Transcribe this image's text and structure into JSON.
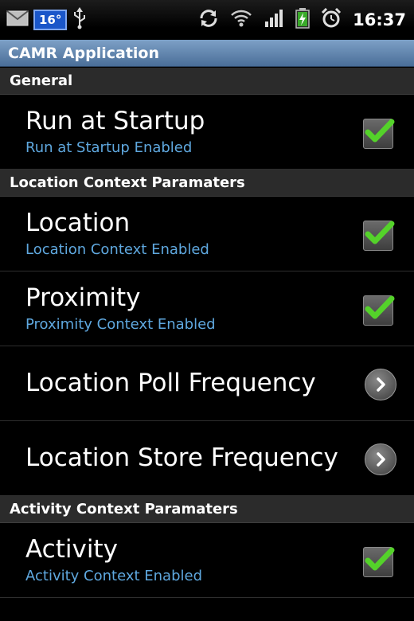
{
  "status_bar": {
    "temperature": "16°",
    "time": "16:37",
    "icons": [
      "mail-icon",
      "usb-icon",
      "sync-icon",
      "wifi-icon",
      "signal-icon",
      "battery-charging-icon",
      "alarm-icon"
    ]
  },
  "app": {
    "title": "CAMR Application"
  },
  "sections": [
    {
      "header": "General",
      "items": [
        {
          "title": "Run at Startup",
          "summary": "Run at Startup Enabled",
          "widget": "checkbox",
          "checked": true
        }
      ]
    },
    {
      "header": "Location Context Paramaters",
      "items": [
        {
          "title": "Location",
          "summary": "Location Context Enabled",
          "widget": "checkbox",
          "checked": true
        },
        {
          "title": "Proximity",
          "summary": "Proximity Context Enabled",
          "widget": "checkbox",
          "checked": true
        },
        {
          "title": "Location Poll Frequency",
          "widget": "chevron"
        },
        {
          "title": "Location Store Frequency",
          "widget": "chevron"
        }
      ]
    },
    {
      "header": "Activity Context Paramaters",
      "items": [
        {
          "title": "Activity",
          "summary": "Activity Context Enabled",
          "widget": "checkbox",
          "checked": true
        }
      ]
    }
  ],
  "colors": {
    "title_bar": "#5b7faa",
    "summary_text": "#5fa8df",
    "check_green": "#54d22a",
    "category_bg": "#2b2b2b"
  }
}
